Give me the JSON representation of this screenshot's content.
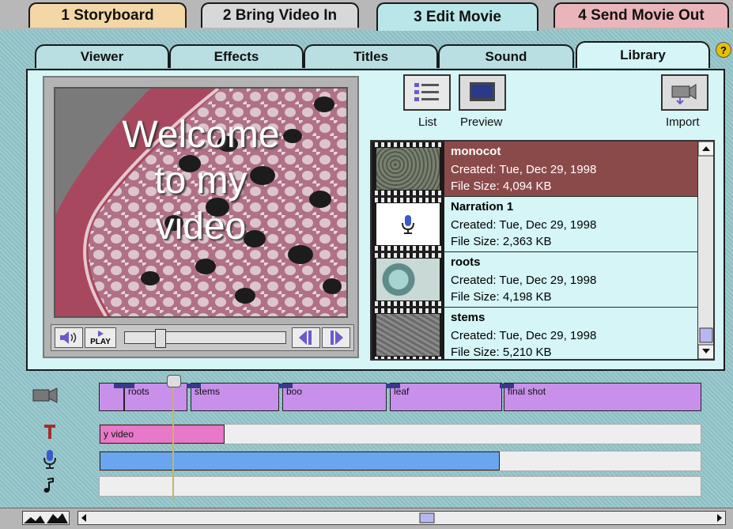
{
  "steps": [
    {
      "label": "1 Storyboard"
    },
    {
      "label": "2 Bring Video In"
    },
    {
      "label": "3 Edit Movie"
    },
    {
      "label": "4 Send Movie Out"
    }
  ],
  "subtabs": [
    {
      "label": "Viewer"
    },
    {
      "label": "Effects"
    },
    {
      "label": "Titles"
    },
    {
      "label": "Sound"
    },
    {
      "label": "Library"
    }
  ],
  "help_label": "?",
  "viewer": {
    "caption": [
      "Welcome",
      "to my",
      "video"
    ],
    "play_label": "PLAY"
  },
  "toolbar": {
    "list_label": "List",
    "preview_label": "Preview",
    "import_label": "Import"
  },
  "library": {
    "items": [
      {
        "name": "monocot",
        "created": "Created: Tue, Dec 29, 1998",
        "size": "File Size: 4,094 KB"
      },
      {
        "name": "Narration 1",
        "created": "Created: Tue, Dec 29, 1998",
        "size": "File Size: 2,363 KB"
      },
      {
        "name": "roots",
        "created": "Created: Tue, Dec 29, 1998",
        "size": "File Size: 4,198 KB"
      },
      {
        "name": "stems",
        "created": "Created: Tue, Dec 29, 1998",
        "size": "File Size: 5,210 KB"
      }
    ]
  },
  "timeline": {
    "video_clips": [
      "roots",
      "stems",
      "boo",
      "leaf",
      "final shot"
    ],
    "title_clip": "y video"
  },
  "colors": {
    "background": "#92c5ca",
    "panel": "#d5f5f6",
    "selected_row": "#8b4a4a",
    "video_clip": "#c890ea",
    "title_clip": "#e878c8",
    "audio_clip": "#6aa6ef"
  }
}
